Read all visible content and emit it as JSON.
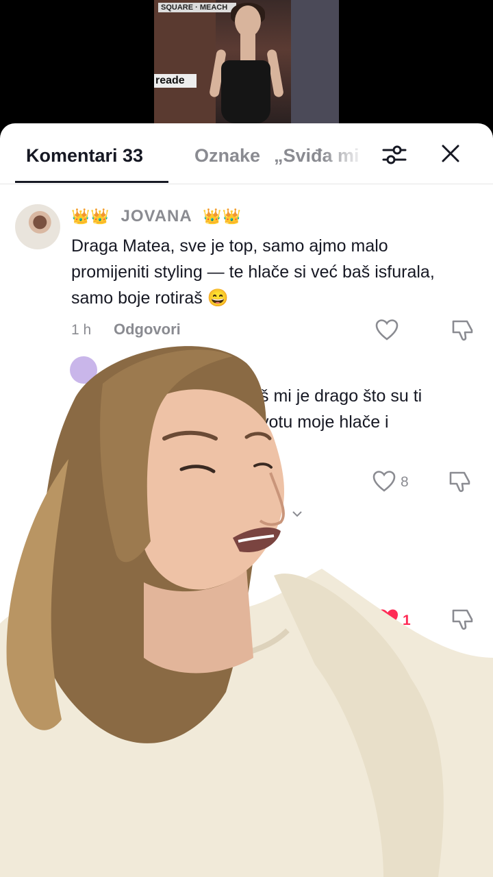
{
  "tabs": {
    "comments_label": "Komentari 33",
    "tags_label": "Oznake",
    "likes_label": "„Sviđa mi"
  },
  "comments": [
    {
      "username": "JOVANA",
      "crowns": "👑👑",
      "text": "Draga Matea, sve je top, samo ajmo malo promijeniti styling — te hlače si već baš isfurala, samo boje rotiraš 😄",
      "time": "1 h",
      "reply_label": "Odgovori"
    },
    {
      "partial_line_1": "š mi je drago što su ti",
      "partial_line_2": "votu moje hlače i",
      "like_count": "8"
    },
    {
      "like_count": "1"
    }
  ],
  "icons": {
    "filter": "sliders-icon",
    "close": "close-icon",
    "like": "heart-icon",
    "dislike": "thumbs-down-icon",
    "expand": "chevron-down-icon"
  },
  "colors": {
    "liked_heart": "#fe2c55",
    "muted_text": "#8a8b91",
    "primary_text": "#161823"
  }
}
